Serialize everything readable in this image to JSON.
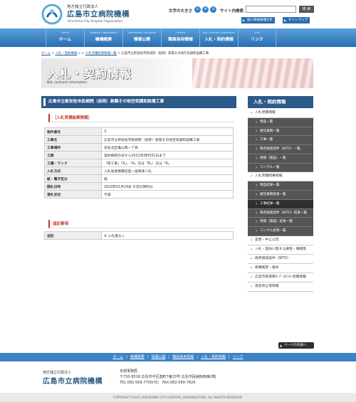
{
  "header": {
    "org_sub": "地方独立行政法人",
    "org_name": "広島市立病院機構",
    "org_en": "Hiroshima City Hospital Organization",
    "fontsize_label": "文字の大きさ",
    "fontsize_buttons": [
      "小",
      "中",
      "大"
    ],
    "search_label": "サイト内検索",
    "search_button": "検 索",
    "privacy_link": "個人情報保護方針",
    "sitemap_link": "サイトマップ"
  },
  "nav": [
    {
      "en": "Home",
      "jp": "ホーム"
    },
    {
      "en": "Hospital Organization",
      "jp": "機構概要"
    },
    {
      "en": "Information disclosure",
      "jp": "情報公開"
    },
    {
      "en": "Careers",
      "jp": "職員採用情報"
    },
    {
      "en": "Bid, contract information",
      "jp": "入札・契約情報"
    },
    {
      "en": "Link",
      "jp": "リンク"
    }
  ],
  "breadcrumb": {
    "items": [
      "ホーム",
      "入札・契約情報",
      "入札見積結果情報一覧"
    ],
    "current": "広島市立新安佐市民病院（仮称）新築その他空気調和設備工事"
  },
  "banner": {
    "title": "入札・契約情報",
    "en": "Bid, contract information."
  },
  "main": {
    "title": "広島市立新安佐市民病院（仮称）新築その他空気調和設備工事",
    "section1": "［入札見積結果情報］",
    "rows": [
      {
        "label": "案件番号",
        "value": "3"
      },
      {
        "label": "工事名",
        "value": "広島市立新安佐市民病院（仮称）新築その他空気調和設備工事"
      },
      {
        "label": "工事場所",
        "value": "安佐北区亀山南一丁目"
      },
      {
        "label": "工期",
        "value": "契約締結の日から2021年08月31日まで"
      },
      {
        "label": "工種・ランク",
        "value": "「管工事」「A」、「A」又は「B」）又は「A」"
      },
      {
        "label": "入札方式",
        "value": "入札後資格確認型一般競争入札"
      },
      {
        "label": "紙・電子区分",
        "value": "紙"
      },
      {
        "label": "開札日時",
        "value": "2019年01月29日 午前10時0分"
      },
      {
        "label": "落札状況",
        "value": "不調"
      }
    ],
    "section2": "追記事項",
    "notes": [
      {
        "label": "追記",
        "value": "※ 入札者なし"
      }
    ]
  },
  "sidebar": {
    "title": "入札・契約情報",
    "items": [
      {
        "label": "入札見積情報",
        "level": 1
      },
      {
        "label": "物品一覧",
        "level": 2
      },
      {
        "label": "委託業務一覧",
        "level": 2
      },
      {
        "label": "工事一覧",
        "level": 2
      },
      {
        "label": "政府調達案件（WTO）一覧",
        "level": 2
      },
      {
        "label": "修繕（施設）一覧",
        "level": 2
      },
      {
        "label": "コンサル一覧",
        "level": 2
      },
      {
        "label": "入札見積結果情報",
        "level": 1
      },
      {
        "label": "物品結果一覧",
        "level": 2
      },
      {
        "label": "委託業務結果一覧",
        "level": 2
      },
      {
        "label": "工事結果一覧",
        "level": 2,
        "active": true
      },
      {
        "label": "政府調達案件（WTO）結果一覧",
        "level": 2
      },
      {
        "label": "修繕（施設）結果一覧",
        "level": 2
      },
      {
        "label": "コンサル結果一覧",
        "level": 2
      },
      {
        "label": "変更・中止公告",
        "level": 1
      },
      {
        "label": "入札・契約に関する規程・要綱等",
        "level": 1
      },
      {
        "label": "政府調達案件（WTO）",
        "level": 1
      },
      {
        "label": "各種帳票・様式",
        "level": 1
      },
      {
        "label": "広島市民病院ｵｰﾌﾟﾝｶｳﾝﾀｰ見積情報",
        "level": 1
      },
      {
        "label": "指名停止等情報",
        "level": 1
      }
    ],
    "pagetop": "ページの先頭へ"
  },
  "footer": {
    "links": [
      "ホーム",
      "機構概要",
      "情報公開",
      "職員採用情報",
      "入札・契約情報",
      "リンク"
    ],
    "org_sub": "地方独立行政法人",
    "org_name": "広島市立病院機構",
    "office": "本部事務局",
    "address": "〒730-8518 広島市中区基町7番33号 広島市民病院西棟2階",
    "tel": "TEL:082-569-7700(代)　FAX:082-569-7826",
    "copyright": "COPYRIGHT©2021 HIROSHIMA CITY HOSPITAL ORGANIZATION. ALL RIGHTS RESERVED."
  }
}
